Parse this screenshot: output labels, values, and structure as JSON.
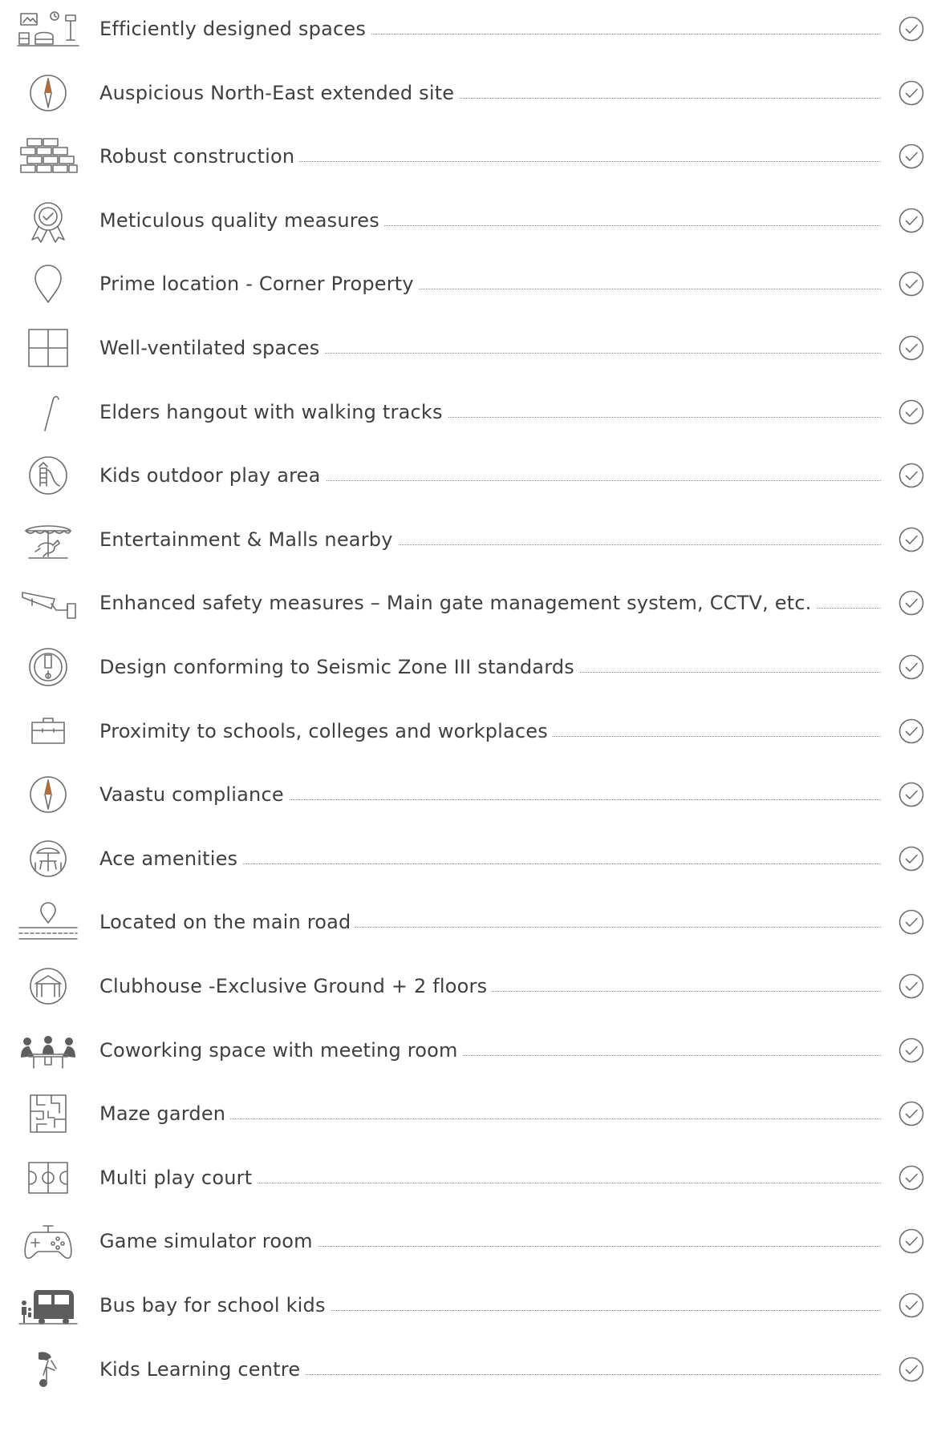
{
  "features": [
    {
      "label": "Efficiently designed spaces",
      "icon": "furniture-icon"
    },
    {
      "label": "Auspicious North-East extended site",
      "icon": "compass-icon"
    },
    {
      "label": "Robust construction",
      "icon": "brick-wall-icon"
    },
    {
      "label": "Meticulous quality measures",
      "icon": "quality-badge-icon"
    },
    {
      "label": "Prime location - Corner Property",
      "icon": "location-pin-icon"
    },
    {
      "label": "Well-ventilated spaces",
      "icon": "window-icon"
    },
    {
      "label": "Elders hangout  with walking tracks",
      "icon": "walking-stick-icon"
    },
    {
      "label": "Kids outdoor play area",
      "icon": "slide-icon"
    },
    {
      "label": "Entertainment & Malls nearby",
      "icon": "carousel-icon"
    },
    {
      "label": "Enhanced safety measures – Main gate management system, CCTV, etc.",
      "icon": "cctv-camera-icon"
    },
    {
      "label": "Design conforming to Seismic Zone III standards",
      "icon": "seismic-icon"
    },
    {
      "label": "Proximity to schools, colleges and workplaces",
      "icon": "briefcase-icon"
    },
    {
      "label": "Vaastu compliance",
      "icon": "compass-icon"
    },
    {
      "label": "Ace amenities",
      "icon": "patio-table-icon"
    },
    {
      "label": "Located on the main road",
      "icon": "road-pin-icon"
    },
    {
      "label": "Clubhouse -Exclusive Ground + 2 floors",
      "icon": "clubhouse-icon"
    },
    {
      "label": "Coworking space with meeting room",
      "icon": "meeting-icon"
    },
    {
      "label": "Maze garden",
      "icon": "maze-icon"
    },
    {
      "label": "Multi play court",
      "icon": "court-icon"
    },
    {
      "label": "Game simulator room",
      "icon": "gamepad-icon"
    },
    {
      "label": "Bus bay for school kids",
      "icon": "school-bus-icon"
    },
    {
      "label": "Kids Learning centre",
      "icon": "learning-icon"
    }
  ],
  "check_icon": "check-circle-icon"
}
